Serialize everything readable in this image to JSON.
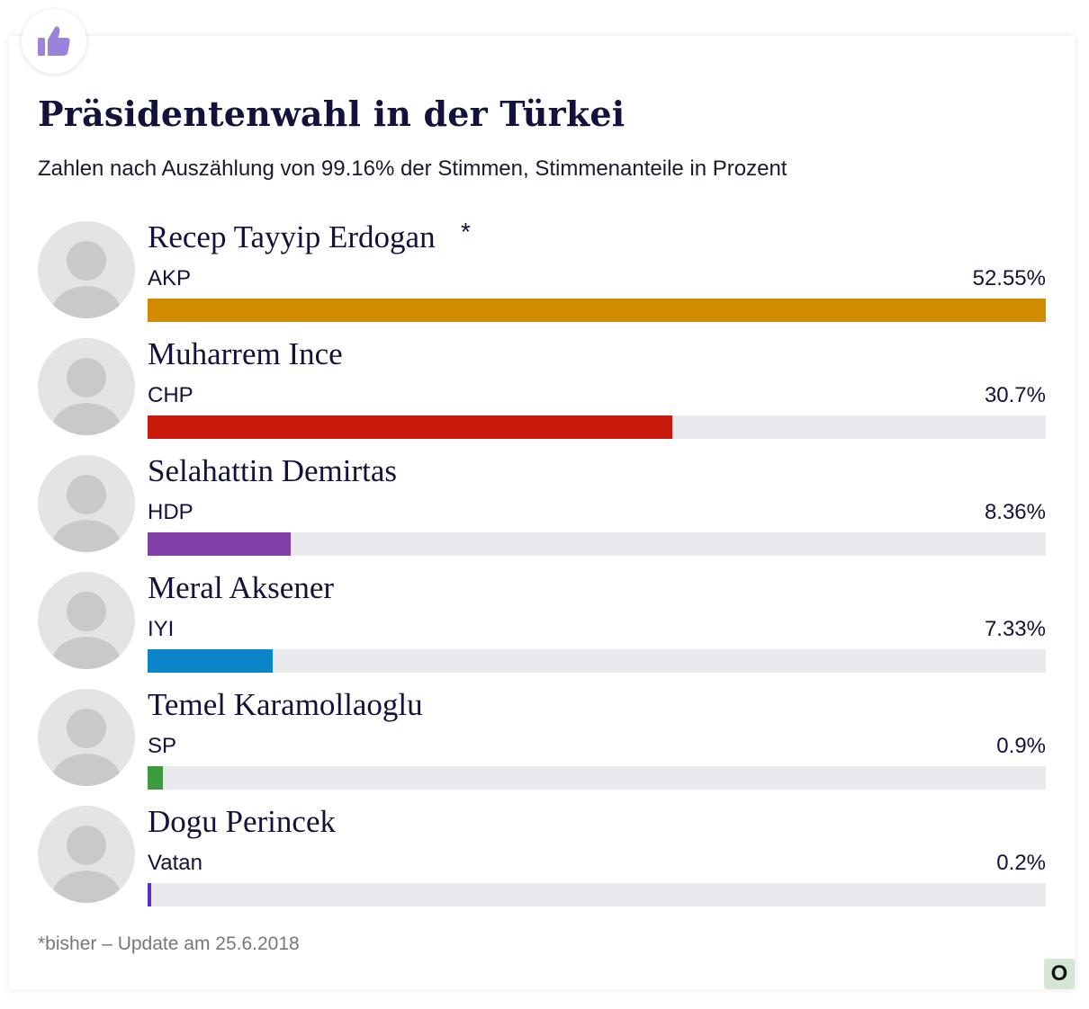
{
  "title": "Präsidentenwahl in der Türkei",
  "subtitle": "Zahlen nach Auszählung von 99.16% der Stimmen, Stimmenanteile in Prozent",
  "footnote": "*bisher – Update am 25.6.2018",
  "logo_letter": "O",
  "chart_data": {
    "type": "bar",
    "orientation": "horizontal",
    "title": "Präsidentenwahl in der Türkei",
    "subtitle": "Zahlen nach Auszählung von 99.16% der Stimmen, Stimmenanteile in Prozent",
    "xlim": [
      0,
      52.55
    ],
    "candidates": [
      {
        "name": "Recep Tayyip Erdogan",
        "marker": "*",
        "party": "AKP",
        "value": 52.55,
        "label": "52.55%",
        "color": "#d18b00"
      },
      {
        "name": "Muharrem Ince",
        "marker": "",
        "party": "CHP",
        "value": 30.7,
        "label": "30.7%",
        "color": "#c8190a"
      },
      {
        "name": "Selahattin Demirtas",
        "marker": "",
        "party": "HDP",
        "value": 8.36,
        "label": "8.36%",
        "color": "#8040a8"
      },
      {
        "name": "Meral Aksener",
        "marker": "",
        "party": "IYI",
        "value": 7.33,
        "label": "7.33%",
        "color": "#0a86c8"
      },
      {
        "name": "Temel Karamollaoglu",
        "marker": "",
        "party": "SP",
        "value": 0.9,
        "label": "0.9%",
        "color": "#3e9a3e"
      },
      {
        "name": "Dogu Perincek",
        "marker": "",
        "party": "Vatan",
        "value": 0.2,
        "label": "0.2%",
        "color": "#5a2fc8"
      }
    ],
    "bar_track_color": "#e8e8ed"
  },
  "icons": {
    "badge": "thumbs-up-icon",
    "badge_color": "#9b82db"
  }
}
